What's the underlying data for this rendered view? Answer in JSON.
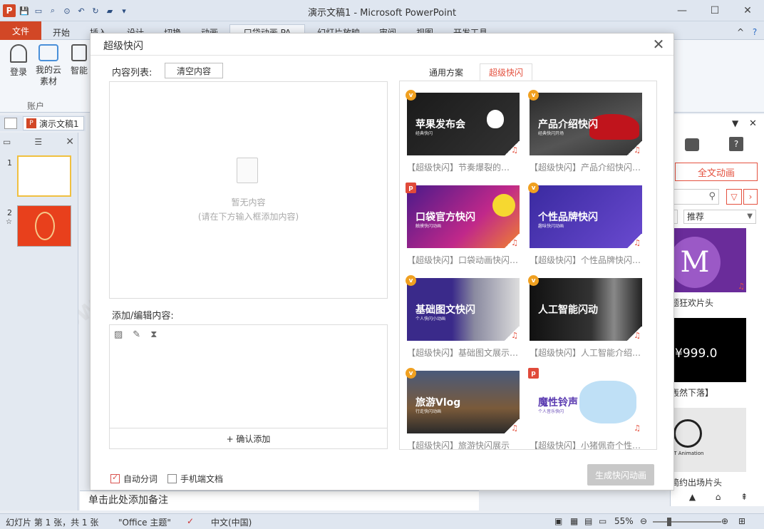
{
  "window": {
    "title": "演示文稿1 - Microsoft PowerPoint"
  },
  "ribbon_tabs": [
    "文件",
    "开始",
    "插入",
    "设计",
    "切换",
    "动画",
    "口袋动画 PA",
    "幻灯片放映",
    "审阅",
    "视图",
    "开发工具"
  ],
  "ribbon": {
    "login": "登录",
    "cloud": "我的云素材",
    "smart": "智能",
    "group": "账户"
  },
  "doc_tab": "演示文稿1",
  "slides": [
    "1",
    "2"
  ],
  "slide_star": "☆",
  "notes_hint": "单击此处添加备注",
  "right_pane": {
    "fulltext_btn": "全文动画",
    "sort": "推荐",
    "items": [
      "题狂欢片头",
      "轰然下落】",
      "简约出场片头"
    ],
    "price": "¥999.0",
    "logo_text": "PT Animation"
  },
  "status": {
    "slide_info": "幻灯片 第 1 张，共 1 张",
    "theme": "\"Office 主题\"",
    "lang": "中文(中国)",
    "zoom": "55%"
  },
  "modal": {
    "title": "超级快闪",
    "content_list_label": "内容列表:",
    "clear_btn": "清空内容",
    "empty_title": "暂无内容",
    "empty_hint": "(请在下方输入框添加内容)",
    "edit_label": "添加/编辑内容:",
    "confirm_add": "+ 确认添加",
    "auto_split": "自动分词",
    "mobile_doc": "手机端文档",
    "generate_btn": "生成快闪动画",
    "tab_general": "通用方案",
    "tab_super": "超级快闪",
    "cards": [
      {
        "title": "苹果发布会",
        "sub": "经典快闪",
        "caption": "【超级快闪】节奏爆裂的…",
        "badge": "v"
      },
      {
        "title": "产品介绍快闪",
        "sub": "经典快闪开场",
        "caption": "【超级快闪】产品介绍快闪…",
        "badge": "v"
      },
      {
        "title": "口袋官方快闪",
        "sub": "触摸快闪动画",
        "caption": "【超级快闪】口袋动画快闪…",
        "badge": "p"
      },
      {
        "title": "个性品牌快闪",
        "sub": "趣味快闪动画",
        "caption": "【超级快闪】个性品牌快闪…",
        "badge": "v"
      },
      {
        "title": "基础图文快闪",
        "sub": "个人快闪小动画",
        "caption": "【超级快闪】基础图文展示…",
        "badge": "v"
      },
      {
        "title": "人工智能闪动",
        "sub": "",
        "caption": "【超级快闪】人工智能介绍…",
        "badge": "v"
      },
      {
        "title": "旅游Vlog",
        "sub": "行走快闪动画",
        "caption": "【超级快闪】旅游快闪展示",
        "badge": "v"
      },
      {
        "title": "魔性铃声",
        "sub": "个人音乐快闪",
        "caption": "【超级快闪】小猪佩奇个性…",
        "badge": "p"
      }
    ]
  },
  "watermark": "WEIDOWN.COM"
}
